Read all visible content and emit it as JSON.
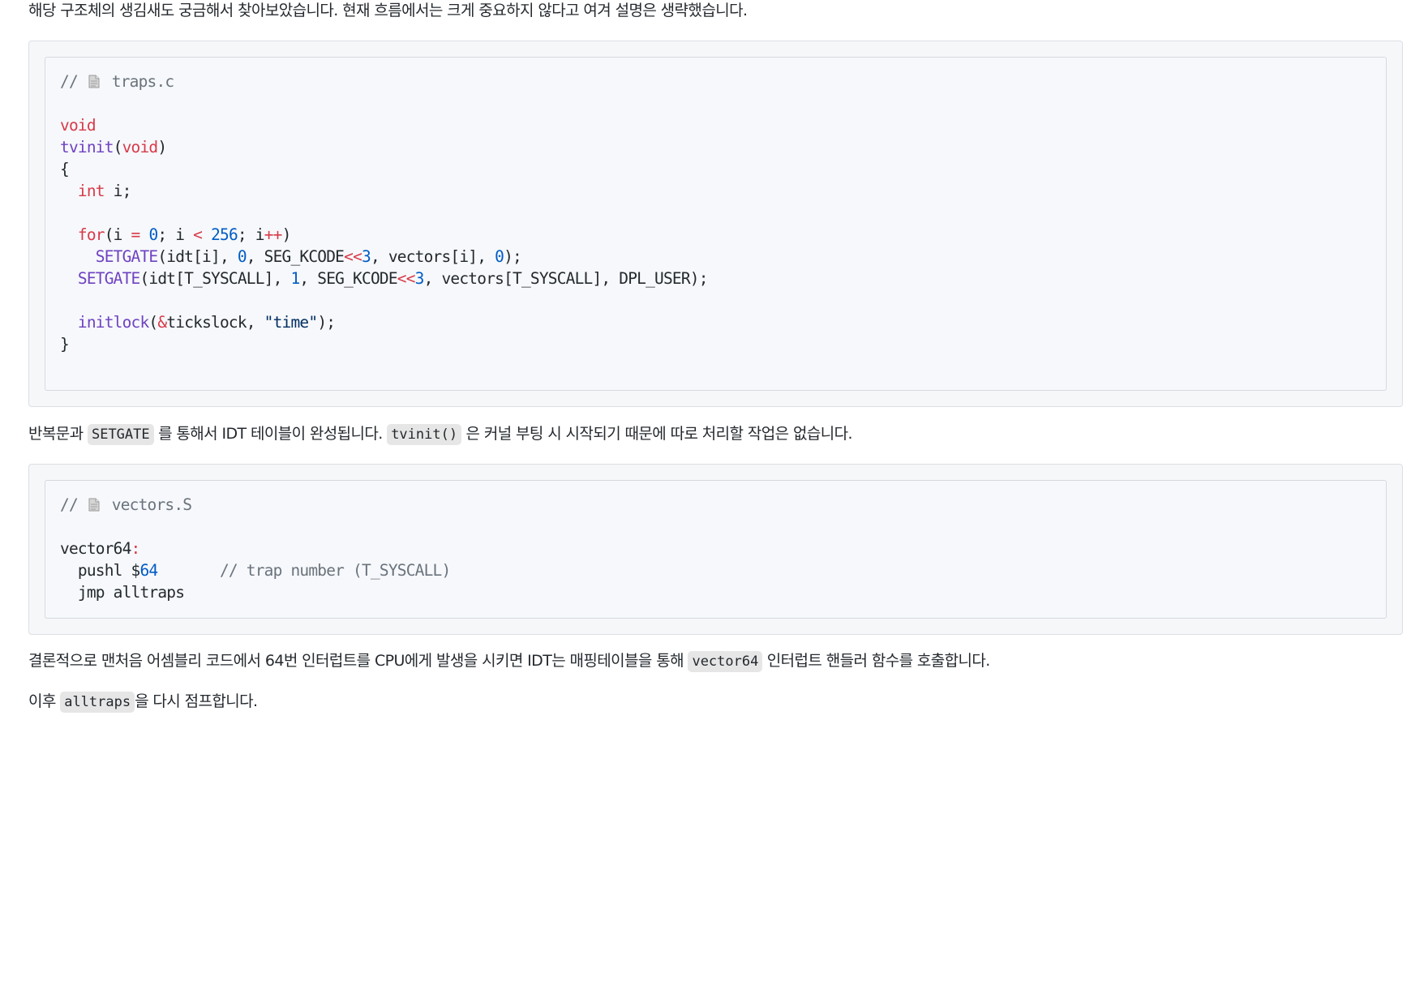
{
  "intro_text": "해당 구조체의 생김새도 궁금해서 찾아보았습니다. 현재 흐름에서는 크게 중요하지 않다고 여겨 설명은 생략했습니다.",
  "code_block_1": {
    "comment_prefix": "// ",
    "icon": "file-icon",
    "filename": "traps.c",
    "line_void": "void",
    "fn_name": "tvinit",
    "param": "void",
    "open_brace": "{",
    "int_kw": "int",
    "int_rest": " i;",
    "for_kw": "for",
    "for_a": "(i ",
    "for_eq": "=",
    "for_b": " ",
    "for_zero": "0",
    "for_c": "; i ",
    "for_lt": "<",
    "for_d": " ",
    "for_256": "256",
    "for_e": "; i",
    "for_pp": "++",
    "for_f": ")",
    "setgate": "SETGATE",
    "sg1_a": "(idt[i], ",
    "sg1_zero": "0",
    "sg1_b": ", SEG_KCODE",
    "sg1_shift": "<<",
    "sg1_three": "3",
    "sg1_c": ", vectors[i], ",
    "sg1_zero2": "0",
    "sg1_d": ");",
    "sg2_a": "(idt[T_SYSCALL], ",
    "sg2_one": "1",
    "sg2_b": ", SEG_KCODE",
    "sg2_shift": "<<",
    "sg2_three": "3",
    "sg2_c": ", vectors[T_SYSCALL], DPL_USER);",
    "initlock": "initlock",
    "il_a": "(",
    "il_amp": "&",
    "il_b": "tickslock, ",
    "il_str": "\"time\"",
    "il_c": ");",
    "close_brace": "}"
  },
  "para_2": {
    "before": "반복문과 ",
    "code_1": "SETGATE",
    "middle": " 를 통해서 IDT 테이블이 완성됩니다. ",
    "code_2": "tvinit()",
    "after": " 은 커널 부팅 시 시작되기 때문에 따로 처리할 작업은 없습니다."
  },
  "code_block_2": {
    "comment_prefix": "// ",
    "icon": "file-icon",
    "filename": "vectors.S",
    "label": "vector64",
    "colon": ":",
    "pushl_a": "  pushl $",
    "pushl_num": "64",
    "pushl_comment": "// trap number (T_SYSCALL)",
    "jmp_line": "  jmp alltraps"
  },
  "para_3": {
    "before": "결론적으로 맨처음 어셈블리 코드에서 64번 인터럽트를 CPU에게 발생을 시키면 IDT는 매핑테이블을 통해 ",
    "code": "vector64",
    "after": " 인터럽트 핸들러 함수를 호출합니다."
  },
  "para_4": {
    "before": "이후 ",
    "code": "alltraps",
    "after": "을 다시 점프합니다."
  }
}
